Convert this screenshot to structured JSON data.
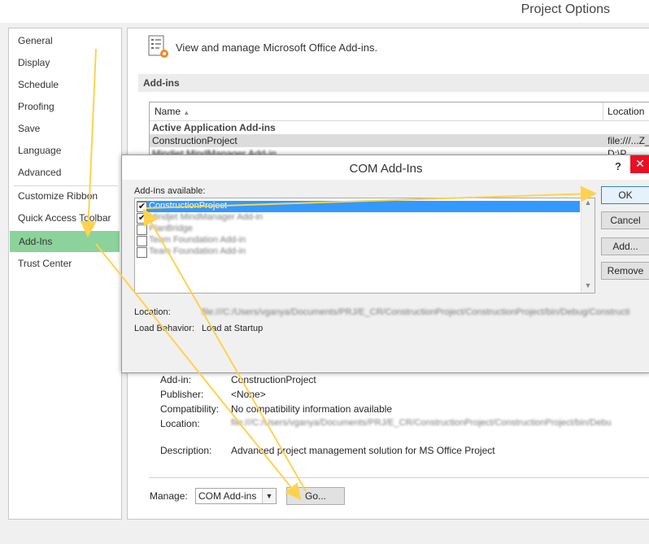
{
  "window": {
    "title": "Project Options"
  },
  "sidebar": {
    "items": [
      {
        "label": "General"
      },
      {
        "label": "Display"
      },
      {
        "label": "Schedule"
      },
      {
        "label": "Proofing"
      },
      {
        "label": "Save"
      },
      {
        "label": "Language"
      },
      {
        "label": "Advanced"
      },
      {
        "label": "Customize Ribbon"
      },
      {
        "label": "Quick Access Toolbar"
      },
      {
        "label": "Add-Ins",
        "selected": true
      },
      {
        "label": "Trust Center"
      }
    ],
    "selected_color": "#8bd39b"
  },
  "main": {
    "header": "View and manage Microsoft Office Add-ins.",
    "section_label": "Add-ins",
    "table": {
      "columns": {
        "name": "Name",
        "sort_glyph": "▲",
        "location": "Location"
      },
      "group_label": "Active Application Add-ins",
      "rows": [
        {
          "name": "ConstructionProject",
          "location": "file:///...Z_"
        },
        {
          "name": "Mindjet MindManager Add-in",
          "location": "D:\\P"
        }
      ]
    },
    "details": {
      "addin_label": "Add-in:",
      "addin_value": "ConstructionProject",
      "publisher_label": "Publisher:",
      "publisher_value": "<None>",
      "compat_label": "Compatibility:",
      "compat_value": "No compatibility information available",
      "location_label": "Location:",
      "location_value": "file:///C:/Users/vganya/Documents/PRJ/E_CR/ConstructionProject/ConstructionProject/bin/Debu",
      "description_label": "Description:",
      "description_value": "Advanced project management solution for MS Office Project"
    },
    "manage": {
      "label": "Manage:",
      "selected": "COM Add-ins",
      "dropdown_glyph": "▼",
      "go_label": "Go..."
    }
  },
  "com_dialog": {
    "title": "COM Add-Ins",
    "help_glyph": "?",
    "close_glyph": "✕",
    "available_label": "Add-Ins available:",
    "addins": [
      {
        "label": "ConstructionProject",
        "checked": true,
        "selected": true
      },
      {
        "label": "Mindjet MindManager Add-in",
        "checked": true
      },
      {
        "label": "PlanBridge",
        "checked": false
      },
      {
        "label": "Team Foundation Add-in",
        "checked": false
      },
      {
        "label": "Team Foundation Add-in",
        "checked": false
      }
    ],
    "check_glyph": "✔",
    "buttons": {
      "ok": "OK",
      "cancel": "Cancel",
      "add": "Add...",
      "remove": "Remove"
    },
    "location_label": "Location:",
    "location_value": "file:///C:/Users/vganya/Documents/PRJ/E_CR/ConstructionProject/ConstructionProject/bin/Debug/Constructi",
    "load_behavior_label": "Load Behavior:",
    "load_behavior_value": "Load at Startup",
    "scroll_up_glyph": "▲",
    "scroll_down_glyph": "▼"
  },
  "annotation": {
    "arrow_color": "#ffd24d"
  }
}
